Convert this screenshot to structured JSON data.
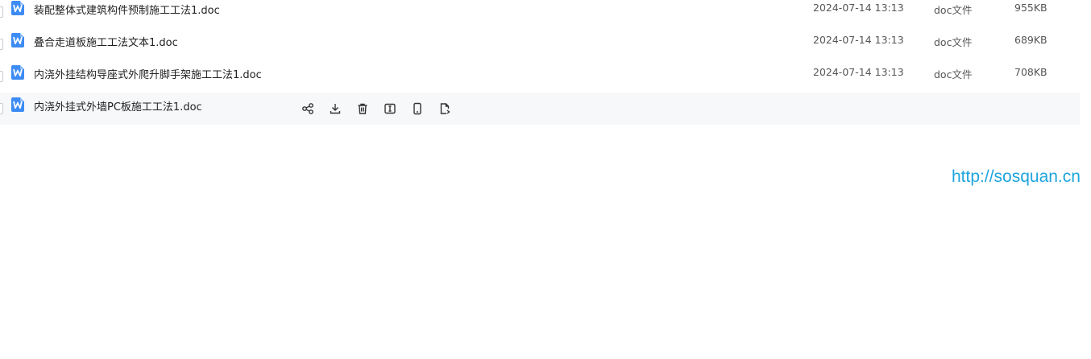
{
  "files": [
    {
      "name": "装配整体式建筑构件预制施工工法1.doc",
      "date": "2024-07-14 13:13",
      "type": "doc文件",
      "size": "955KB",
      "icon": "word-doc-icon"
    },
    {
      "name": "叠合走道板施工工法文本1.doc",
      "date": "2024-07-14 13:13",
      "type": "doc文件",
      "size": "689KB",
      "icon": "word-doc-icon"
    },
    {
      "name": "内浇外挂结构导座式外爬升脚手架施工工法1.doc",
      "date": "2024-07-14 13:13",
      "type": "doc文件",
      "size": "708KB",
      "icon": "word-doc-icon"
    },
    {
      "name": "内浇外挂式外墙PC板施工工法1.doc",
      "icon": "word-doc-icon",
      "hovered": true,
      "actions": [
        "share-icon",
        "download-icon",
        "delete-icon",
        "rename-icon",
        "mobile-icon",
        "copy-file-icon"
      ]
    }
  ],
  "watermark": "http://sosquan.cn",
  "colors": {
    "accent": "#3d8cf5",
    "hover_row": "#f7f8fa",
    "watermark": "#1ea5de"
  }
}
